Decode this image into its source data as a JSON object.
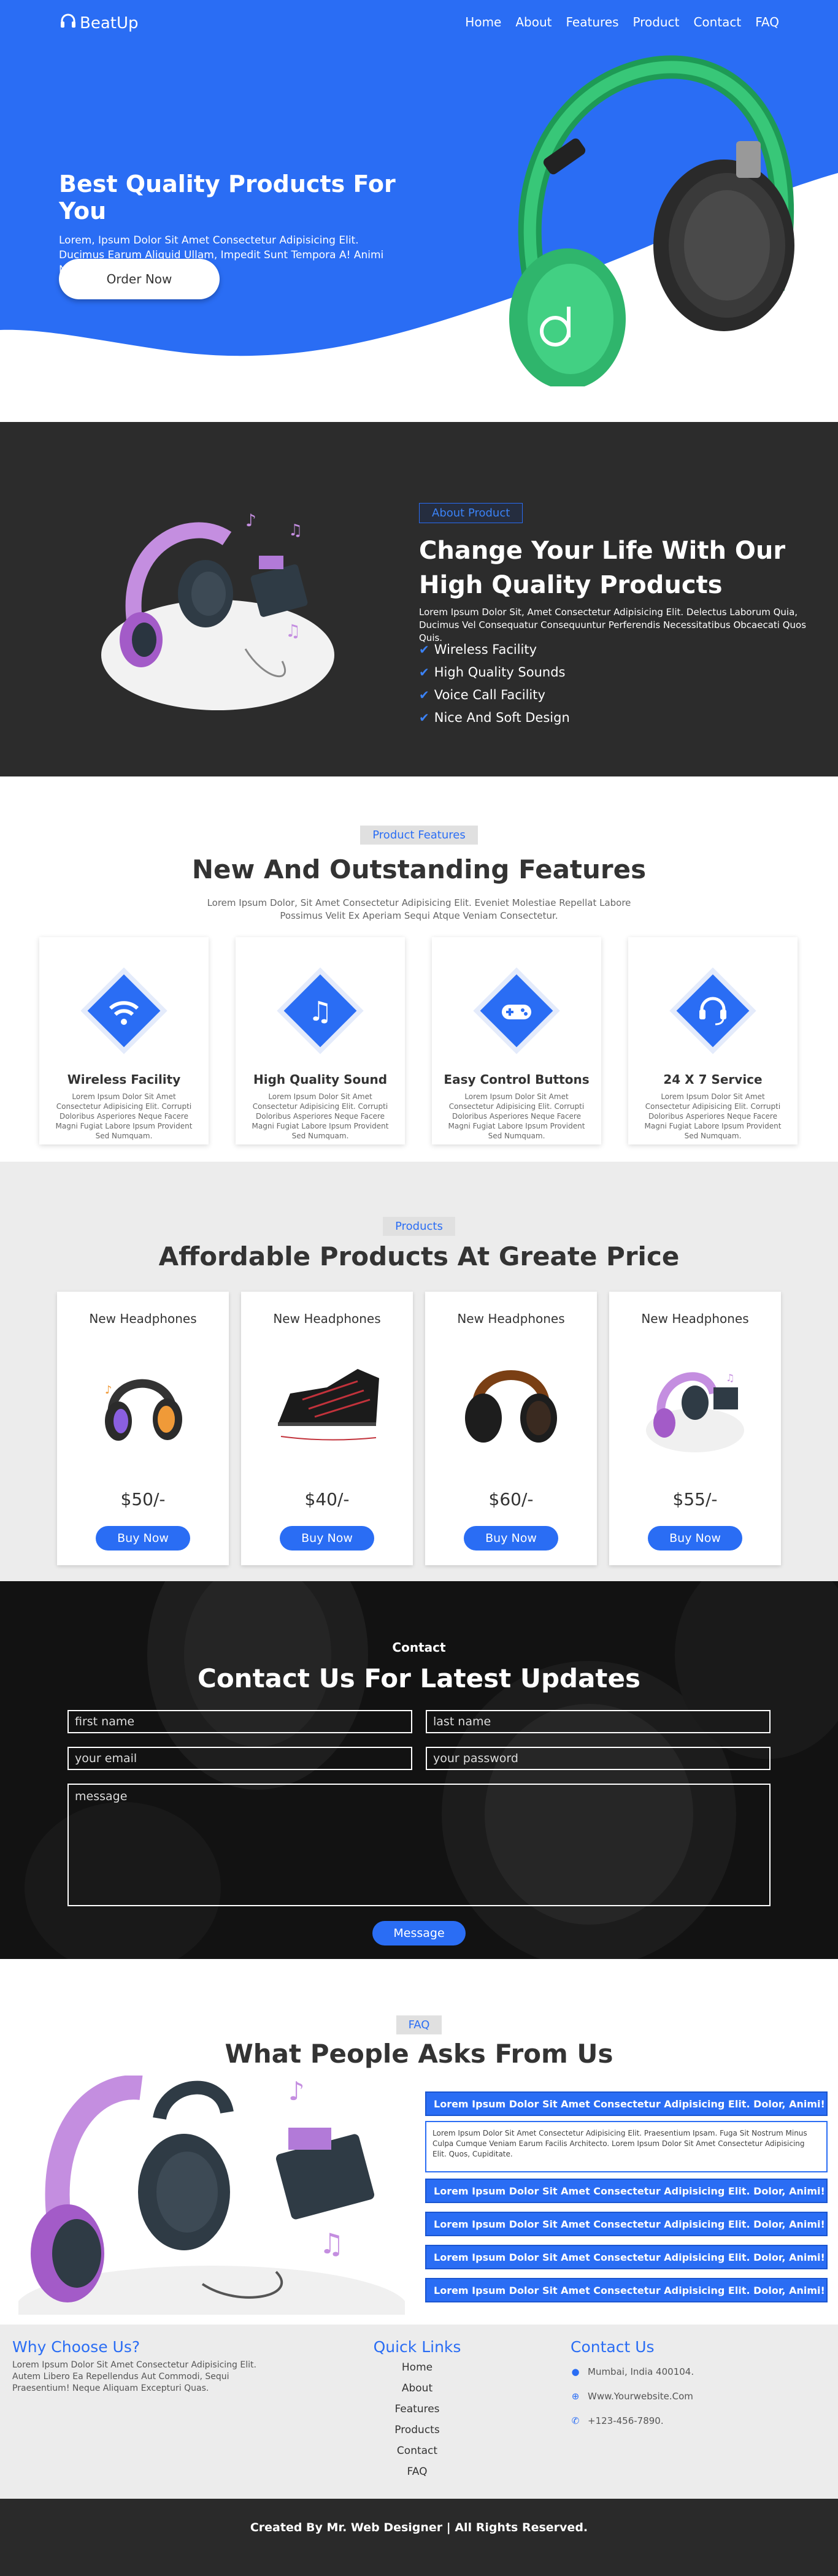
{
  "brand": {
    "name": "BeatUp",
    "accent": "#2a6df4"
  },
  "nav": {
    "items": [
      "Home",
      "About",
      "Features",
      "Product",
      "Contact",
      "FAQ"
    ]
  },
  "hero": {
    "title": "Best Quality Products For You",
    "desc": "Lorem, Ipsum Dolor Sit Amet Consectetur Adipisicing Elit. Ducimus Earum Aliquid Ullam, Impedit Sunt Tempora A! Animi Nihil Sunt Beatae.",
    "button": "Order Now"
  },
  "about": {
    "tag": "About Product",
    "title": "Change Your Life With Our High Quality Products",
    "desc": "Lorem Ipsum Dolor Sit, Amet Consectetur Adipisicing Elit. Delectus Laborum Quia, Ducimus Vel Consequatur Consequuntur Perferendis Necessitatibus Obcaecati Quos Quis.",
    "list": [
      "Wireless Facility",
      "High Quality Sounds",
      "Voice Call Facility",
      "Nice And Soft Design"
    ]
  },
  "features": {
    "tag": "Product Features",
    "title": "New And Outstanding Features",
    "desc_line1": "Lorem Ipsum Dolor, Sit Amet Consectetur Adipisicing Elit. Eveniet Molestiae Repellat Labore",
    "desc_line2": "Possimus Velit Ex Aperiam Sequi Atque Veniam Consectetur.",
    "cards": [
      {
        "title": "Wireless Facility",
        "icon": "wifi-icon",
        "desc": "Lorem Ipsum Dolor Sit Amet Consectetur Adipisicing Elit. Corrupti Doloribus Asperiores Neque Facere Magni Fugiat Labore Ipsum Provident Sed Numquam."
      },
      {
        "title": "High Quality Sound",
        "icon": "music-icon",
        "desc": "Lorem Ipsum Dolor Sit Amet Consectetur Adipisicing Elit. Corrupti Doloribus Asperiores Neque Facere Magni Fugiat Labore Ipsum Provident Sed Numquam."
      },
      {
        "title": "Easy Control Buttons",
        "icon": "gamepad-icon",
        "desc": "Lorem Ipsum Dolor Sit Amet Consectetur Adipisicing Elit. Corrupti Doloribus Asperiores Neque Facere Magni Fugiat Labore Ipsum Provident Sed Numquam."
      },
      {
        "title": "24 X 7 Service",
        "icon": "headset-icon",
        "desc": "Lorem Ipsum Dolor Sit Amet Consectetur Adipisicing Elit. Corrupti Doloribus Asperiores Neque Facere Magni Fugiat Labore Ipsum Provident Sed Numquam."
      }
    ]
  },
  "products": {
    "tag": "Products",
    "title": "Affordable Products At Greate Price",
    "items": [
      {
        "name": "New Headphones",
        "price": "$50/-",
        "button": "Buy Now"
      },
      {
        "name": "New Headphones",
        "price": "$40/-",
        "button": "Buy Now"
      },
      {
        "name": "New Headphones",
        "price": "$60/-",
        "button": "Buy Now"
      },
      {
        "name": "New Headphones",
        "price": "$55/-",
        "button": "Buy Now"
      }
    ]
  },
  "contact": {
    "label": "Contact",
    "title": "Contact Us For Latest Updates",
    "first_name": "first name",
    "last_name": "last name",
    "email": "your email",
    "password": "your password",
    "message": "message",
    "button": "Message"
  },
  "faq": {
    "tag": "FAQ",
    "title": "What People Asks From Us",
    "question": "Lorem Ipsum Dolor Sit Amet Consectetur Adipisicing Elit. Dolor, Animi!",
    "answer": "Lorem Ipsum Dolor Sit Amet Consectetur Adipisicing Elit. Praesentium Ipsam. Fuga Sit Nostrum Minus Culpa Cumque Veniam Earum Facilis Architecto. Lorem Ipsum Dolor Sit Amet Consectetur Adipisicing Elit. Quos, Cupiditate."
  },
  "footer": {
    "why_title": "Why Choose Us?",
    "why_desc": "Lorem Ipsum Dolor Sit Amet Consectetur Adipisicing Elit. Autem Libero Ea Repellendus Aut Commodi, Sequi Praesentium! Neque Aliquam Excepturi Quas.",
    "links_title": "Quick Links",
    "links": [
      "Home",
      "About",
      "Features",
      "Products",
      "Contact",
      "FAQ"
    ],
    "contact_title": "Contact Us",
    "address": "Mumbai, India 400104.",
    "website": "Www.Yourwebsite.Com",
    "phone": "+123-456-7890.",
    "copyright": "Created By Mr. Web Designer | All Rights Reserved."
  }
}
